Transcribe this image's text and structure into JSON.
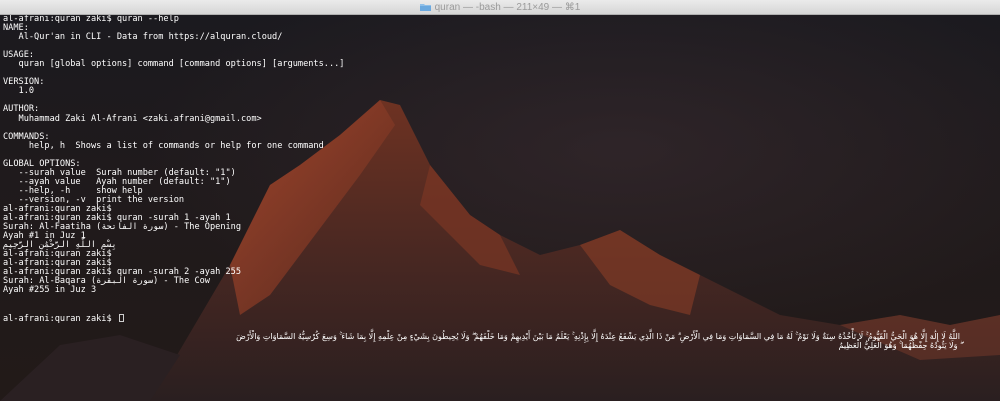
{
  "window": {
    "title": "quran — -bash — 211×49 — ⌘1",
    "folder_icon": "folder-icon"
  },
  "terminal": {
    "lines": [
      "al-afrani:quran zaki$ quran --help",
      "NAME:",
      "   Al-Qur'an in CLI - Data from https://alquran.cloud/",
      "",
      "USAGE:",
      "   quran [global options] command [command options] [arguments...]",
      "",
      "VERSION:",
      "   1.0",
      "",
      "AUTHOR:",
      "   Muhammad Zaki Al-Afrani <zaki.afrani@gmail.com>",
      "",
      "COMMANDS:",
      "     help, h  Shows a list of commands or help for one command",
      "",
      "GLOBAL OPTIONS:",
      "   --surah value  Surah number (default: \"1\")",
      "   --ayah value   Ayah number (default: \"1\")",
      "   --help, -h     show help",
      "   --version, -v  print the version",
      "al-afrani:quran zaki$",
      "al-afrani:quran zaki$ quran -surah 1 -ayah 1",
      "Surah: Al-Faatiha (سورة الفاتحة) - The Opening",
      "Ayah #1 in Juz 1",
      "بِسْمِ اللَّهِ الرَّحْمَٰنِ الرَّحِيمِ",
      "al-afrani:quran zaki$",
      "al-afrani:quran zaki$",
      "al-afrani:quran zaki$ quran -surah 2 -ayah 255",
      "Surah: Al-Baqara (سورة البقرة) - The Cow",
      "Ayah #255 in Juz 3",
      "",
      "",
      "al-afrani:quran zaki$ "
    ],
    "ayah_255_line_1": "اللَّهُ لَا إِلَٰهَ إِلَّا هُوَ الْحَيُّ الْقَيُّومُ ۚ لَا تَأْخُذُهُ سِنَةٌ وَلَا نَوْمٌ ۚ لَهُ مَا فِي السَّمَاوَاتِ وَمَا فِي الْأَرْضِ ۗ مَنْ ذَا الَّذِي يَشْفَعُ عِنْدَهُ إِلَّا بِإِذْنِهِ ۚ يَعْلَمُ مَا بَيْنَ أَيْدِيهِمْ وَمَا خَلْفَهُمْ ۖ وَلَا يُحِيطُونَ بِشَيْءٍ مِنْ عِلْمِهِ إِلَّا بِمَا شَاءَ ۚ وَسِعَ كُرْسِيُّهُ السَّمَاوَاتِ وَالْأَرْضَ",
    "ayah_255_line_2": "ۖ وَلَا يَئُودُهُ حِفْظُهُمَا ۚ وَهُوَ الْعَلِيُّ الْعَظِيمُ",
    "cursor_icon": "block-cursor-icon"
  },
  "colors": {
    "text": "#ffffff",
    "titlebar_text": "#9a9a9a",
    "mountain_glow": "#c0563a"
  }
}
